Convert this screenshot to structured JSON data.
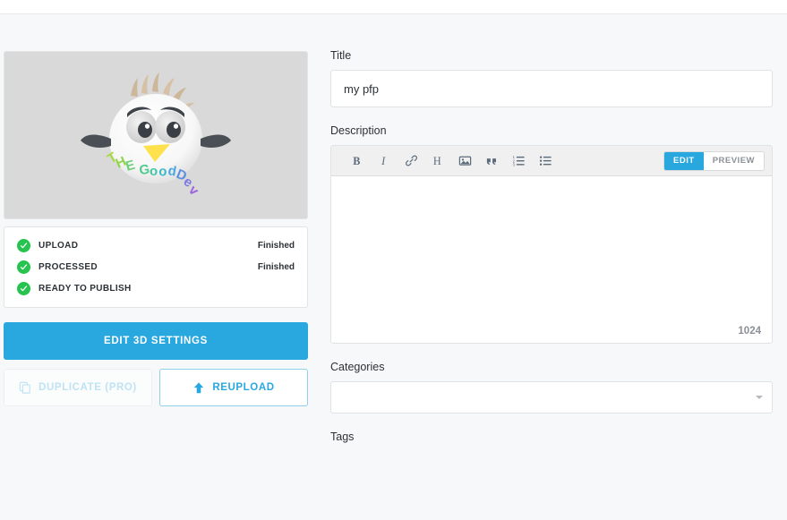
{
  "thumbnail": {
    "alt_name": "3d-bird-character-preview",
    "caption_text": "THE GOOD DEV",
    "background_color": "#d9d9d9"
  },
  "status_list": [
    {
      "label": "UPLOAD",
      "value": "Finished",
      "icon": "check-circle-icon"
    },
    {
      "label": "PROCESSED",
      "value": "Finished",
      "icon": "check-circle-icon"
    },
    {
      "label": "READY TO PUBLISH",
      "value": "",
      "icon": "check-circle-icon"
    }
  ],
  "actions": {
    "primary_label": "EDIT 3D SETTINGS",
    "duplicate_label": "DUPLICATE (PRO)",
    "reupload_label": "REUPLOAD",
    "primary_color": "#29a8df"
  },
  "form": {
    "title_label": "Title",
    "title_value": "my pfp",
    "title_placeholder": "",
    "description_label": "Description",
    "description_value": "",
    "description_placeholder": "",
    "char_count": "1024",
    "categories_label": "Categories",
    "categories_value": "",
    "tags_label": "Tags"
  },
  "editor": {
    "tools": [
      {
        "name": "bold-icon",
        "title": "Bold"
      },
      {
        "name": "italic-icon",
        "title": "Italic"
      },
      {
        "name": "link-icon",
        "title": "Link"
      },
      {
        "name": "heading-icon",
        "title": "Heading"
      },
      {
        "name": "image-icon",
        "title": "Image"
      },
      {
        "name": "quote-icon",
        "title": "Quote"
      },
      {
        "name": "ordered-list-icon",
        "title": "Ordered List"
      },
      {
        "name": "unordered-list-icon",
        "title": "Unordered List"
      }
    ],
    "edit_label": "EDIT",
    "preview_label": "PREVIEW",
    "active_mode": "EDIT"
  }
}
